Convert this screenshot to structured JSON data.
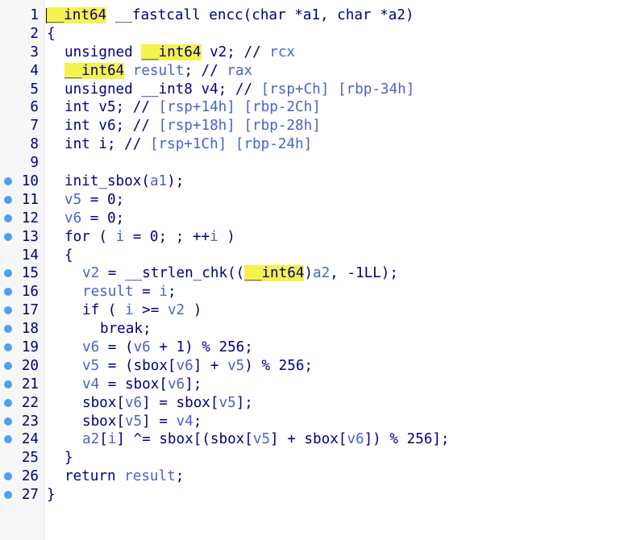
{
  "colors": {
    "code": "#000080",
    "variable": "#4a62c9",
    "highlight": "#f6f24d",
    "breakpoint_dot": "#4aa3f0",
    "gutter": "#f7f7f7"
  },
  "lines": [
    {
      "num": "1",
      "dot": false,
      "indent": 0,
      "tokens": [
        {
          "t": "__int64",
          "c": "hl"
        },
        {
          "t": " __fastcall encc(char *a1, char *a2)",
          "c": "plain"
        }
      ]
    },
    {
      "num": "2",
      "dot": false,
      "indent": 0,
      "tokens": [
        {
          "t": "{",
          "c": "plain"
        }
      ]
    },
    {
      "num": "3",
      "dot": false,
      "indent": 1,
      "tokens": [
        {
          "t": "unsigned ",
          "c": "plain"
        },
        {
          "t": "__int64",
          "c": "hl"
        },
        {
          "t": " v2; // ",
          "c": "plain"
        },
        {
          "t": "rcx",
          "c": "var"
        }
      ]
    },
    {
      "num": "4",
      "dot": false,
      "indent": 1,
      "tokens": [
        {
          "t": "__int64",
          "c": "hl"
        },
        {
          "t": " ",
          "c": "plain"
        },
        {
          "t": "result",
          "c": "var"
        },
        {
          "t": "; // ",
          "c": "plain"
        },
        {
          "t": "rax",
          "c": "var"
        }
      ]
    },
    {
      "num": "5",
      "dot": false,
      "indent": 1,
      "tokens": [
        {
          "t": "unsigned __int8 v4; // ",
          "c": "plain"
        },
        {
          "t": "[rsp+Ch] [rbp-34h]",
          "c": "var"
        }
      ]
    },
    {
      "num": "6",
      "dot": false,
      "indent": 1,
      "tokens": [
        {
          "t": "int v5; // ",
          "c": "plain"
        },
        {
          "t": "[rsp+14h] [rbp-2Ch]",
          "c": "var"
        }
      ]
    },
    {
      "num": "7",
      "dot": false,
      "indent": 1,
      "tokens": [
        {
          "t": "int v6; // ",
          "c": "plain"
        },
        {
          "t": "[rsp+18h] [rbp-28h]",
          "c": "var"
        }
      ]
    },
    {
      "num": "8",
      "dot": false,
      "indent": 1,
      "tokens": [
        {
          "t": "int i; // ",
          "c": "plain"
        },
        {
          "t": "[rsp+1Ch] [rbp-24h]",
          "c": "var"
        }
      ]
    },
    {
      "num": "9",
      "dot": false,
      "indent": 0,
      "tokens": []
    },
    {
      "num": "10",
      "dot": true,
      "indent": 1,
      "tokens": [
        {
          "t": "init_sbox(",
          "c": "plain"
        },
        {
          "t": "a1",
          "c": "var"
        },
        {
          "t": ");",
          "c": "plain"
        }
      ]
    },
    {
      "num": "11",
      "dot": true,
      "indent": 1,
      "tokens": [
        {
          "t": "v5",
          "c": "var"
        },
        {
          "t": " = 0;",
          "c": "plain"
        }
      ]
    },
    {
      "num": "12",
      "dot": true,
      "indent": 1,
      "tokens": [
        {
          "t": "v6",
          "c": "var"
        },
        {
          "t": " = 0;",
          "c": "plain"
        }
      ]
    },
    {
      "num": "13",
      "dot": true,
      "indent": 1,
      "tokens": [
        {
          "t": "for ( ",
          "c": "plain"
        },
        {
          "t": "i",
          "c": "var"
        },
        {
          "t": " = 0; ; ++",
          "c": "plain"
        },
        {
          "t": "i",
          "c": "var"
        },
        {
          "t": " )",
          "c": "plain"
        }
      ]
    },
    {
      "num": "14",
      "dot": false,
      "indent": 1,
      "tokens": [
        {
          "t": "{",
          "c": "plain"
        }
      ]
    },
    {
      "num": "15",
      "dot": true,
      "indent": 2,
      "tokens": [
        {
          "t": "v2",
          "c": "var"
        },
        {
          "t": " = __strlen_chk((",
          "c": "plain"
        },
        {
          "t": "__int64",
          "c": "hl"
        },
        {
          "t": ")",
          "c": "plain"
        },
        {
          "t": "a2",
          "c": "var"
        },
        {
          "t": ", -1LL);",
          "c": "plain"
        }
      ]
    },
    {
      "num": "16",
      "dot": true,
      "indent": 2,
      "tokens": [
        {
          "t": "result",
          "c": "var"
        },
        {
          "t": " = ",
          "c": "plain"
        },
        {
          "t": "i",
          "c": "var"
        },
        {
          "t": ";",
          "c": "plain"
        }
      ]
    },
    {
      "num": "17",
      "dot": true,
      "indent": 2,
      "tokens": [
        {
          "t": "if ( ",
          "c": "plain"
        },
        {
          "t": "i",
          "c": "var"
        },
        {
          "t": " >= ",
          "c": "plain"
        },
        {
          "t": "v2",
          "c": "var"
        },
        {
          "t": " )",
          "c": "plain"
        }
      ]
    },
    {
      "num": "18",
      "dot": true,
      "indent": 3,
      "tokens": [
        {
          "t": "break;",
          "c": "plain"
        }
      ]
    },
    {
      "num": "19",
      "dot": true,
      "indent": 2,
      "tokens": [
        {
          "t": "v6",
          "c": "var"
        },
        {
          "t": " = (",
          "c": "plain"
        },
        {
          "t": "v6",
          "c": "var"
        },
        {
          "t": " + 1) % 256;",
          "c": "plain"
        }
      ]
    },
    {
      "num": "20",
      "dot": true,
      "indent": 2,
      "tokens": [
        {
          "t": "v5",
          "c": "var"
        },
        {
          "t": " = (sbox[",
          "c": "plain"
        },
        {
          "t": "v6",
          "c": "var"
        },
        {
          "t": "] + ",
          "c": "plain"
        },
        {
          "t": "v5",
          "c": "var"
        },
        {
          "t": ") % 256;",
          "c": "plain"
        }
      ]
    },
    {
      "num": "21",
      "dot": true,
      "indent": 2,
      "tokens": [
        {
          "t": "v4",
          "c": "var"
        },
        {
          "t": " = sbox[",
          "c": "plain"
        },
        {
          "t": "v6",
          "c": "var"
        },
        {
          "t": "];",
          "c": "plain"
        }
      ]
    },
    {
      "num": "22",
      "dot": true,
      "indent": 2,
      "tokens": [
        {
          "t": "sbox[",
          "c": "plain"
        },
        {
          "t": "v6",
          "c": "var"
        },
        {
          "t": "] = sbox[",
          "c": "plain"
        },
        {
          "t": "v5",
          "c": "var"
        },
        {
          "t": "];",
          "c": "plain"
        }
      ]
    },
    {
      "num": "23",
      "dot": true,
      "indent": 2,
      "tokens": [
        {
          "t": "sbox[",
          "c": "plain"
        },
        {
          "t": "v5",
          "c": "var"
        },
        {
          "t": "] = ",
          "c": "plain"
        },
        {
          "t": "v4",
          "c": "var"
        },
        {
          "t": ";",
          "c": "plain"
        }
      ]
    },
    {
      "num": "24",
      "dot": true,
      "indent": 2,
      "tokens": [
        {
          "t": "a2",
          "c": "var"
        },
        {
          "t": "[",
          "c": "plain"
        },
        {
          "t": "i",
          "c": "var"
        },
        {
          "t": "] ^= sbox[(sbox[",
          "c": "plain"
        },
        {
          "t": "v5",
          "c": "var"
        },
        {
          "t": "] + sbox[",
          "c": "plain"
        },
        {
          "t": "v6",
          "c": "var"
        },
        {
          "t": "]) % 256];",
          "c": "plain"
        }
      ]
    },
    {
      "num": "25",
      "dot": false,
      "indent": 1,
      "tokens": [
        {
          "t": "}",
          "c": "plain"
        }
      ]
    },
    {
      "num": "26",
      "dot": true,
      "indent": 1,
      "tokens": [
        {
          "t": "return ",
          "c": "plain"
        },
        {
          "t": "result",
          "c": "var"
        },
        {
          "t": ";",
          "c": "plain"
        }
      ]
    },
    {
      "num": "27",
      "dot": true,
      "indent": 0,
      "tokens": [
        {
          "t": "}",
          "c": "plain"
        }
      ]
    }
  ]
}
